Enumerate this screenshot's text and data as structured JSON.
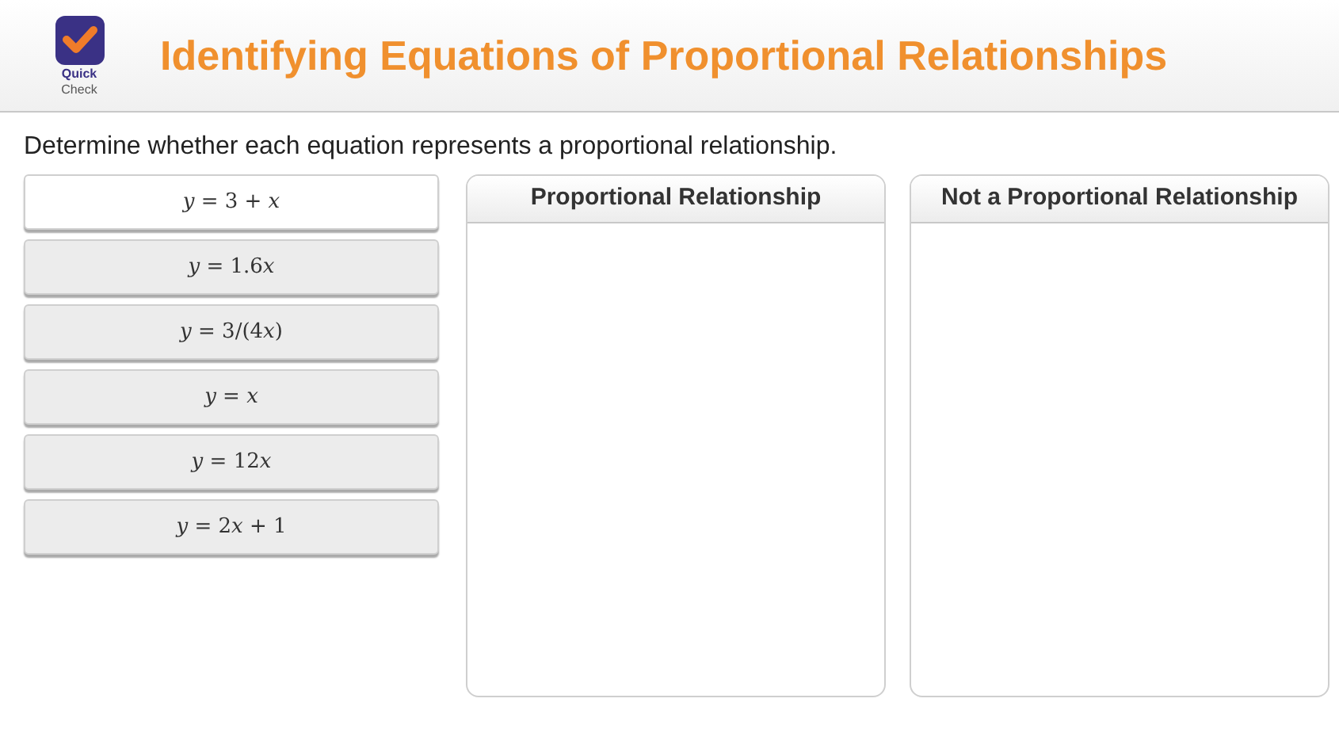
{
  "header": {
    "badge_lines": [
      "Quick",
      "Check"
    ],
    "title": "Identifying Equations of Proportional Relationships"
  },
  "instruction": "Determine whether each equation represents a proportional relationship.",
  "cards": [
    {
      "label": "y = 3 + x",
      "selected": true
    },
    {
      "label": "y = 1.6x",
      "selected": false
    },
    {
      "label": "y = 3/(4x)",
      "selected": false
    },
    {
      "label": "y = x",
      "selected": false
    },
    {
      "label": "y = 12x",
      "selected": false
    },
    {
      "label": "y = 2x + 1",
      "selected": false
    }
  ],
  "bins": [
    {
      "title": "Proportional Relationship"
    },
    {
      "title": "Not a Proportional Relationship"
    }
  ]
}
